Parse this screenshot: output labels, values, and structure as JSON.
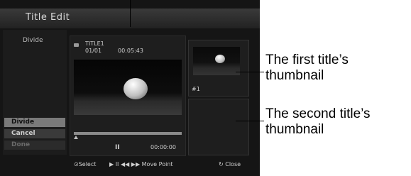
{
  "screen": {
    "title": "Title Edit",
    "mode_label": "Divide",
    "menu": {
      "divide": "Divide",
      "cancel": "Cancel",
      "done": "Done"
    },
    "player": {
      "title_name": "TITLE1",
      "chapter": "01/01",
      "time_code": "00:05:43",
      "pause_icon": "II",
      "play_time": "00:00:00"
    },
    "thumbnails": {
      "first_label": "#1"
    },
    "footer": {
      "select": "⊙Select",
      "move_point": "▶ II ◀◀ ▶▶ Move Point",
      "close": "↻ Close"
    }
  },
  "annotations": {
    "first_thumbnail": [
      "The first title’s",
      "thumbnail"
    ],
    "second_thumbnail": [
      "The second title’s",
      "thumbnail"
    ]
  },
  "icons": {
    "title_icon": "disc-icon",
    "pause_icon": "pause-icon",
    "progress_marker": "marker-triangle-icon"
  }
}
